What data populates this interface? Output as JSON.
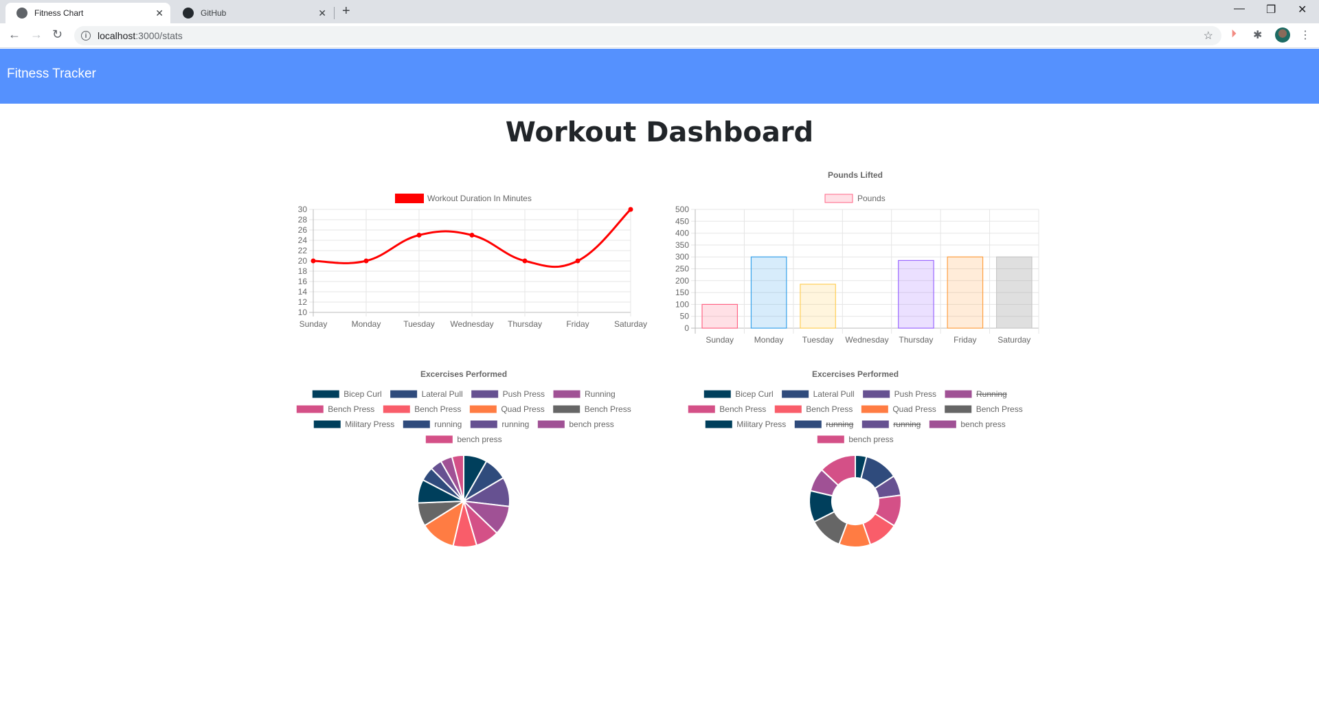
{
  "browser": {
    "tabs": [
      {
        "title": "Fitness Chart",
        "active": true,
        "icon": "globe-icon"
      },
      {
        "title": "GitHub",
        "active": false,
        "icon": "github-icon"
      }
    ],
    "new_tab_label": "+",
    "url_host": "localhost",
    "url_path": ":3000/stats",
    "window_controls": {
      "minimize": "—",
      "restore": "❐",
      "close": "✕"
    }
  },
  "navbar": {
    "brand": "Fitness Tracker",
    "color": "#5591fe"
  },
  "page": {
    "title": "Workout Dashboard"
  },
  "chart_data": [
    {
      "type": "line",
      "title": "",
      "legend": [
        "Workout Duration In Minutes"
      ],
      "legend_position": "top",
      "categories": [
        "Sunday",
        "Monday",
        "Tuesday",
        "Wednesday",
        "Thursday",
        "Friday",
        "Saturday"
      ],
      "series": [
        {
          "name": "Workout Duration In Minutes",
          "values": [
            20,
            20,
            25,
            25,
            20,
            20,
            30
          ],
          "color": "#ff0000"
        }
      ],
      "ylim": [
        10,
        30
      ],
      "yticks": [
        10,
        12,
        14,
        16,
        18,
        20,
        22,
        24,
        26,
        28,
        30
      ],
      "grid": true
    },
    {
      "type": "bar",
      "title": "Pounds Lifted",
      "legend": [
        "Pounds"
      ],
      "legend_position": "top",
      "categories": [
        "Sunday",
        "Monday",
        "Tuesday",
        "Wednesday",
        "Thursday",
        "Friday",
        "Saturday"
      ],
      "values": [
        100,
        300,
        185,
        0,
        285,
        300,
        300
      ],
      "fill_colors": [
        "rgba(255,99,132,0.2)",
        "rgba(54,162,235,0.2)",
        "rgba(255,206,86,0.2)",
        "rgba(75,192,192,0.2)",
        "rgba(153,102,255,0.2)",
        "rgba(255,159,64,0.2)",
        "rgba(150,150,150,0.3)"
      ],
      "border_colors": [
        "rgba(255,99,132,1)",
        "rgba(54,162,235,1)",
        "rgba(255,206,86,1)",
        "rgba(75,192,192,1)",
        "rgba(153,102,255,1)",
        "rgba(255,159,64,1)",
        "rgba(200,200,200,1)"
      ],
      "ylim": [
        0,
        500
      ],
      "yticks": [
        0,
        50,
        100,
        150,
        200,
        250,
        300,
        350,
        400,
        450,
        500
      ],
      "grid": true
    },
    {
      "type": "pie",
      "title": "Excercises Performed",
      "legend_position": "top",
      "labels": [
        "Bicep Curl",
        "Lateral Pull",
        "Push Press",
        "Running",
        "Bench Press",
        "Bench Press",
        "Quad Press",
        "Bench Press",
        "Military Press",
        "running",
        "running",
        "bench press",
        "bench press"
      ],
      "values": [
        20,
        20,
        25,
        25,
        20,
        20,
        30,
        20,
        20,
        12,
        10,
        10,
        10
      ],
      "hidden": [
        false,
        false,
        false,
        false,
        false,
        false,
        false,
        false,
        false,
        false,
        false,
        false,
        false
      ],
      "colors": [
        "#003f5c",
        "#2f4b7c",
        "#665191",
        "#a05195",
        "#d45087",
        "#f95d6a",
        "#ff7c43",
        "#666666",
        "#003f5c",
        "#2f4b7c",
        "#665191",
        "#a05195",
        "#d45087"
      ]
    },
    {
      "type": "doughnut",
      "title": "Excercises Performed",
      "legend_position": "top",
      "labels": [
        "Bicep Curl",
        "Lateral Pull",
        "Push Press",
        "Running",
        "Bench Press",
        "Bench Press",
        "Quad Press",
        "Bench Press",
        "Military Press",
        "running",
        "running",
        "bench press",
        "bench press"
      ],
      "values": [
        10,
        30,
        18,
        0,
        28,
        27,
        28,
        30,
        28,
        0,
        0,
        21,
        33
      ],
      "hidden": [
        false,
        false,
        false,
        true,
        false,
        false,
        false,
        false,
        false,
        true,
        true,
        false,
        false
      ],
      "colors": [
        "#003f5c",
        "#2f4b7c",
        "#665191",
        "#a05195",
        "#d45087",
        "#f95d6a",
        "#ff7c43",
        "#666666",
        "#003f5c",
        "#2f4b7c",
        "#665191",
        "#a05195",
        "#d45087"
      ]
    }
  ]
}
